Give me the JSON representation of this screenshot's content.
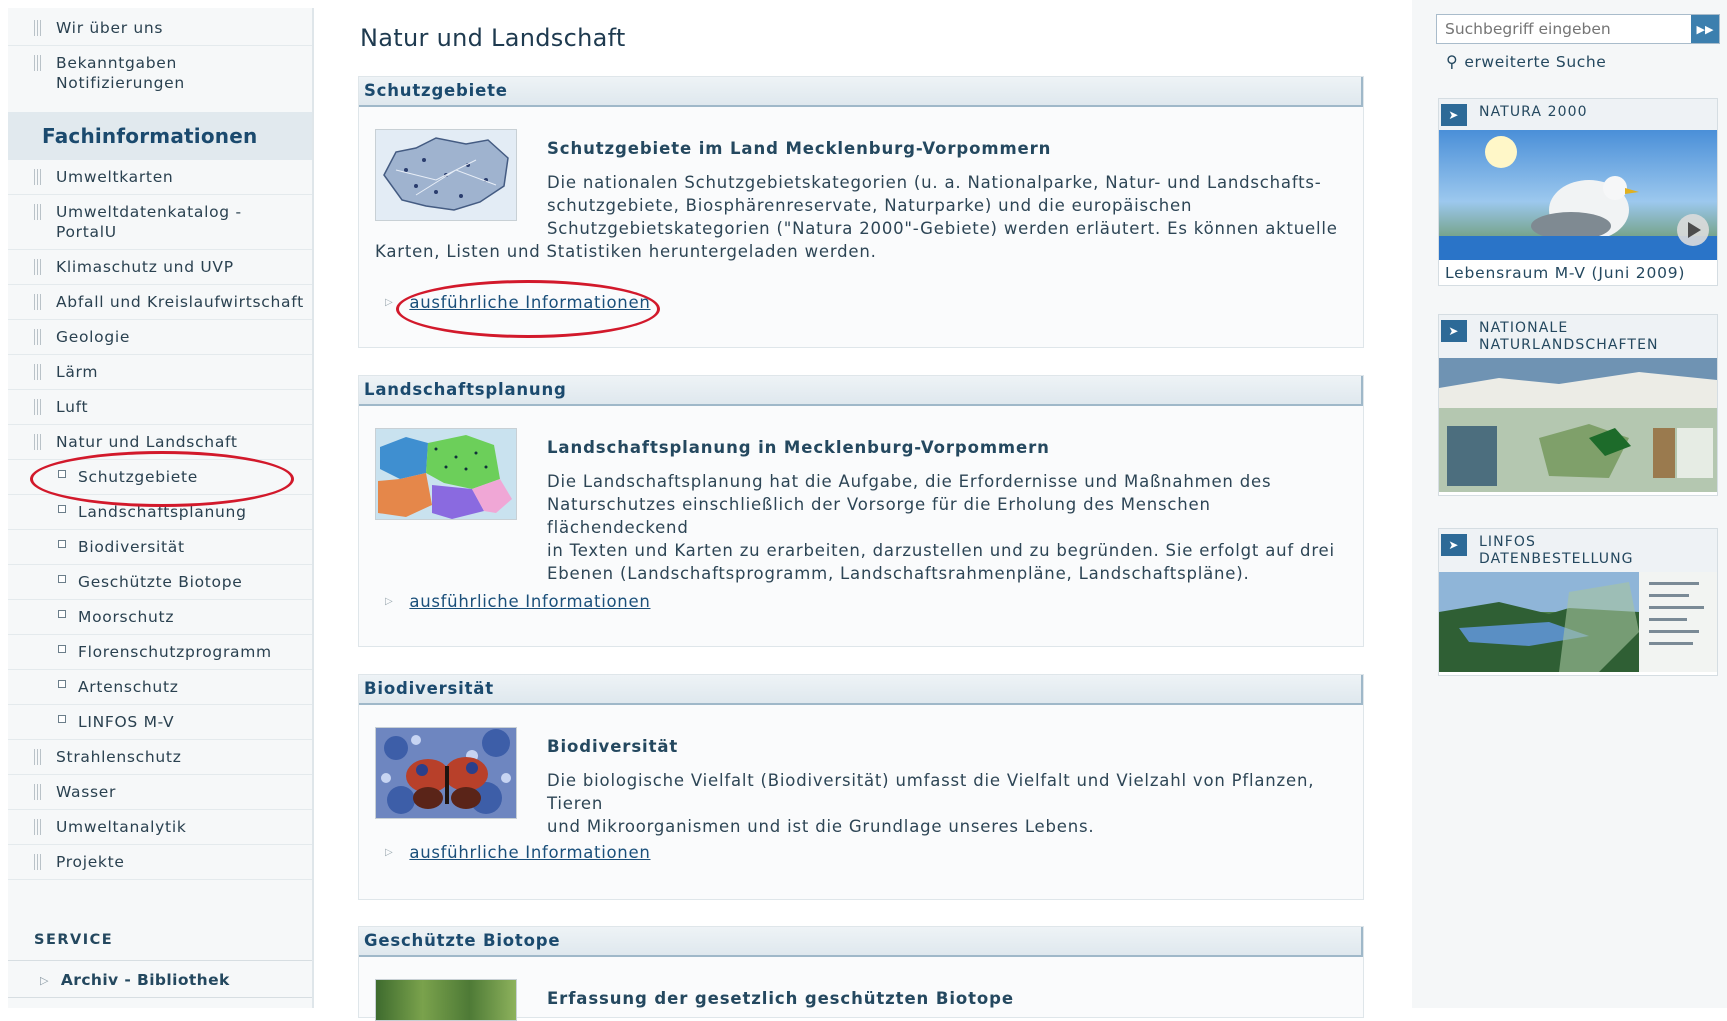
{
  "sidebar": {
    "top_items": [
      "Wir über uns",
      "Bekanntgaben Notifizierungen"
    ],
    "heading": "Fachinformationen",
    "items": [
      "Umweltkarten",
      "Umweltdatenkatalog - PortalU",
      "Klimaschutz und UVP",
      "Abfall und Kreislaufwirtschaft",
      "Geologie",
      "Lärm",
      "Luft",
      "Natur und Landschaft"
    ],
    "sub_items": [
      "Schutzgebiete",
      "Landschaftsplanung",
      "Biodiversität",
      "Geschützte Biotope",
      "Moorschutz",
      "Florenschutzprogramm",
      "Artenschutz",
      "LINFOS M-V"
    ],
    "items_after": [
      "Strahlenschutz",
      "Wasser",
      "Umweltanalytik",
      "Projekte"
    ],
    "service_heading": "SERVICE",
    "service_items": [
      "Archiv - Bibliothek"
    ]
  },
  "main": {
    "title": "Natur und Landschaft",
    "sections": [
      {
        "header": "Schutzgebiete",
        "title": "Schutzgebiete im Land Mecklenburg-Vorpommern",
        "text_lines": [
          "Die nationalen Schutzgebietskategorien (u. a. Nationalparke, Natur- und Landschafts-",
          "schutzgebiete, Biosphärenreservate, Naturparke) und die europäischen",
          "Schutzgebietskategorien (\"Natura 2000\"-Gebiete) werden erläutert. Es können aktuelle",
          "Karten, Listen und Statistiken heruntergeladen werden."
        ],
        "link": "ausführliche Informationen"
      },
      {
        "header": "Landschaftsplanung",
        "title": "Landschaftsplanung in Mecklenburg-Vorpommern",
        "text_lines": [
          "Die Landschaftsplanung hat die Aufgabe, die Erfordernisse und Maßnahmen des",
          "Naturschutzes einschließlich der Vorsorge für die Erholung des Menschen flächendeckend",
          "in Texten und Karten zu erarbeiten, darzustellen und zu begründen. Sie erfolgt auf drei",
          "Ebenen (Landschaftsprogramm, Landschaftsrahmenpläne, Landschaftspläne)."
        ],
        "link": "ausführliche Informationen"
      },
      {
        "header": "Biodiversität",
        "title": "Biodiversität",
        "text_lines": [
          "Die biologische Vielfalt (Biodiversität) umfasst die Vielfalt und Vielzahl von Pflanzen, Tieren",
          "und Mikroorganismen und ist die Grundlage unseres Lebens."
        ],
        "link": "ausführliche Informationen"
      },
      {
        "header": "Geschützte Biotope",
        "title": "Erfassung der gesetzlich geschützten Biotope"
      }
    ]
  },
  "right": {
    "search_placeholder": "Suchbegriff eingeben",
    "advanced_search": "erweiterte Suche",
    "teasers": [
      {
        "title": "NATURA 2000",
        "caption": "Lebensraum M-V (Juni 2009)"
      },
      {
        "title": "NATIONALE NATURLANDSCHAFTEN"
      },
      {
        "title": "LINFOS DATENBESTELLUNG"
      }
    ]
  },
  "colors": {
    "accent": "#1b4a6e",
    "highlight_circle": "#d2192b",
    "link": "#1a4f7a"
  }
}
